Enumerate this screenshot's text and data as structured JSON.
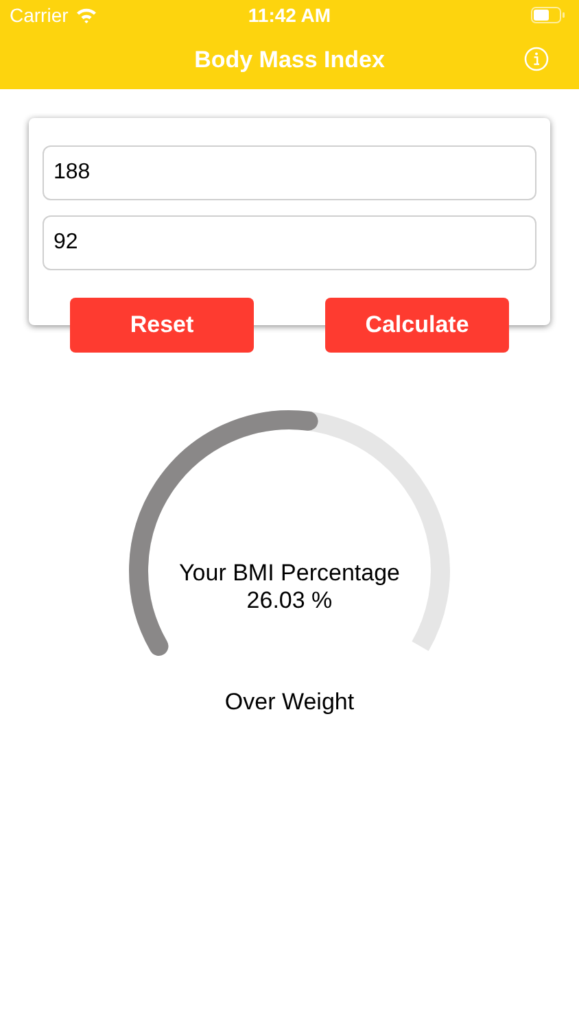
{
  "status_bar": {
    "carrier": "Carrier",
    "time": "11:42 AM"
  },
  "nav_bar": {
    "title": "Body Mass Index"
  },
  "form": {
    "fields": [
      {
        "value": "188"
      },
      {
        "value": "92"
      }
    ],
    "buttons": [
      "Reset",
      "Calculate"
    ]
  },
  "gauge": {
    "label": "Your BMI Percentage",
    "reading": "26.03 %"
  },
  "result": "Over Weight"
}
